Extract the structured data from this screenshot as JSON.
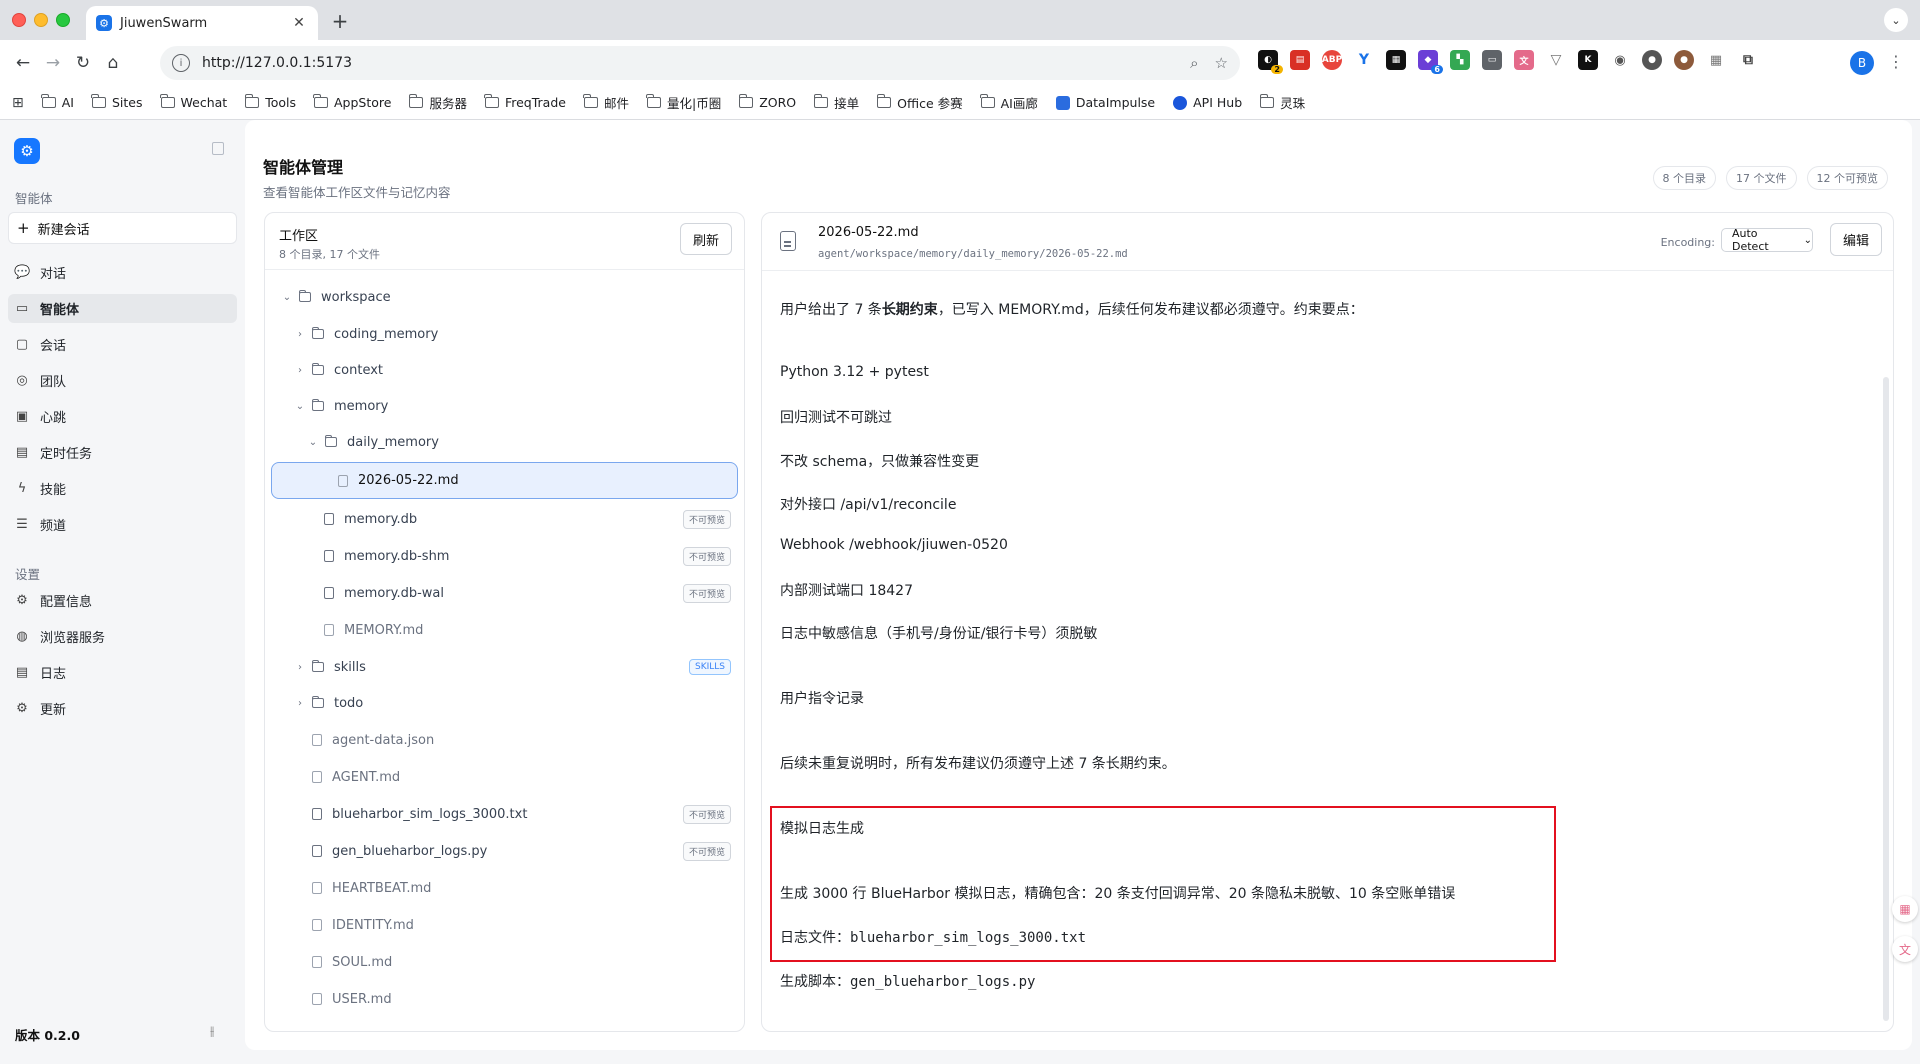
{
  "browser": {
    "tab_title": "JiuwenSwarm",
    "url": "http://127.0.0.1:5173",
    "profile_initial": "B",
    "bookmarks": [
      "AI",
      "Sites",
      "Wechat",
      "Tools",
      "AppStore",
      "服务器",
      "FreqTrade",
      "邮件",
      "量化|币圈",
      "ZORO",
      "接单",
      "Office 参赛",
      "AI画廊",
      "DataImpulse",
      "API Hub",
      "灵珠"
    ],
    "extension_badges": {
      "ext1": "2",
      "ext6": "6"
    }
  },
  "sidebar": {
    "section_agents": "智能体",
    "new_chat": "新建会话",
    "items": [
      {
        "label": "对话",
        "icon": "chat-icon"
      },
      {
        "label": "智能体",
        "icon": "agent-icon"
      },
      {
        "label": "会话",
        "icon": "session-icon"
      },
      {
        "label": "团队",
        "icon": "team-icon"
      },
      {
        "label": "心跳",
        "icon": "heartbeat-icon"
      },
      {
        "label": "定时任务",
        "icon": "schedule-icon"
      },
      {
        "label": "技能",
        "icon": "skill-icon"
      },
      {
        "label": "频道",
        "icon": "channel-icon"
      }
    ],
    "section_settings": "设置",
    "settings_items": [
      {
        "label": "配置信息",
        "icon": "config-icon"
      },
      {
        "label": "浏览器服务",
        "icon": "globe-icon"
      },
      {
        "label": "日志",
        "icon": "log-icon"
      },
      {
        "label": "更新",
        "icon": "update-icon"
      }
    ],
    "version": "版本 0.2.0"
  },
  "page": {
    "title": "智能体管理",
    "subtitle": "查看智能体工作区文件与记忆内容",
    "stats": [
      "8 个目录",
      "17 个文件",
      "12 个可预览"
    ]
  },
  "workspace": {
    "title": "工作区",
    "summary": "8 个目录, 17 个文件",
    "refresh": "刷新",
    "tree": [
      {
        "label": "workspace",
        "type": "folder",
        "expanded": true
      },
      {
        "label": "coding_memory",
        "type": "folder",
        "expanded": false
      },
      {
        "label": "context",
        "type": "folder",
        "expanded": false
      },
      {
        "label": "memory",
        "type": "folder",
        "expanded": true
      },
      {
        "label": "daily_memory",
        "type": "folder",
        "expanded": true
      },
      {
        "label": "2026-05-22.md",
        "type": "doc",
        "selected": true
      },
      {
        "label": "memory.db",
        "type": "file",
        "badge": "不可预览"
      },
      {
        "label": "memory.db-shm",
        "type": "file",
        "badge": "不可预览"
      },
      {
        "label": "memory.db-wal",
        "type": "file",
        "badge": "不可预览"
      },
      {
        "label": "MEMORY.md",
        "type": "doc"
      },
      {
        "label": "skills",
        "type": "folder",
        "expanded": false,
        "badge": "SKILLS"
      },
      {
        "label": "todo",
        "type": "folder",
        "expanded": false
      },
      {
        "label": "agent-data.json",
        "type": "doc"
      },
      {
        "label": "AGENT.md",
        "type": "doc"
      },
      {
        "label": "blueharbor_sim_logs_3000.txt",
        "type": "file",
        "badge": "不可预览"
      },
      {
        "label": "gen_blueharbor_logs.py",
        "type": "file",
        "badge": "不可预览"
      },
      {
        "label": "HEARTBEAT.md",
        "type": "doc"
      },
      {
        "label": "IDENTITY.md",
        "type": "doc"
      },
      {
        "label": "SOUL.md",
        "type": "doc"
      },
      {
        "label": "USER.md",
        "type": "doc"
      }
    ]
  },
  "viewer": {
    "file_name": "2026-05-22.md",
    "file_path": "agent/workspace/memory/daily_memory/2026-05-22.md",
    "encoding_label": "Encoding:",
    "encoding_value": "Auto Detect",
    "edit": "编辑",
    "intro_prefix": "用户给出了 7 条",
    "intro_bold": "长期约束",
    "intro_suffix": "，已写入 MEMORY.md，后续任何发布建议都必须遵守。约束要点：",
    "constraints": [
      "Python 3.12 + pytest",
      "回归测试不可跳过",
      "不改 schema，只做兼容性变更",
      "对外接口 /api/v1/reconcile",
      "Webhook /webhook/jiuwen-0520",
      "内部测试端口 18427",
      "日志中敏感信息（手机号/身份证/银行卡号）须脱敏"
    ],
    "heading_commands": "用户指令记录",
    "commands_note": "后续未重复说明时，所有发布建议仍须遵守上述 7 条长期约束。",
    "heading_sim": "模拟日志生成",
    "sim_desc": "生成 3000 行 BlueHarbor 模拟日志，精确包含：20 条支付回调异常、20 条隐私未脱敏、10 条空账单错误",
    "log_file_label": "日志文件：",
    "log_file": "blueharbor_sim_logs_3000.txt",
    "script_label": "生成脚本：",
    "script_file": "gen_blueharbor_logs.py"
  },
  "colors": {
    "accent": "#1677ff",
    "highlight_border": "#e3101f",
    "selected_row": "#e8f0fe"
  }
}
